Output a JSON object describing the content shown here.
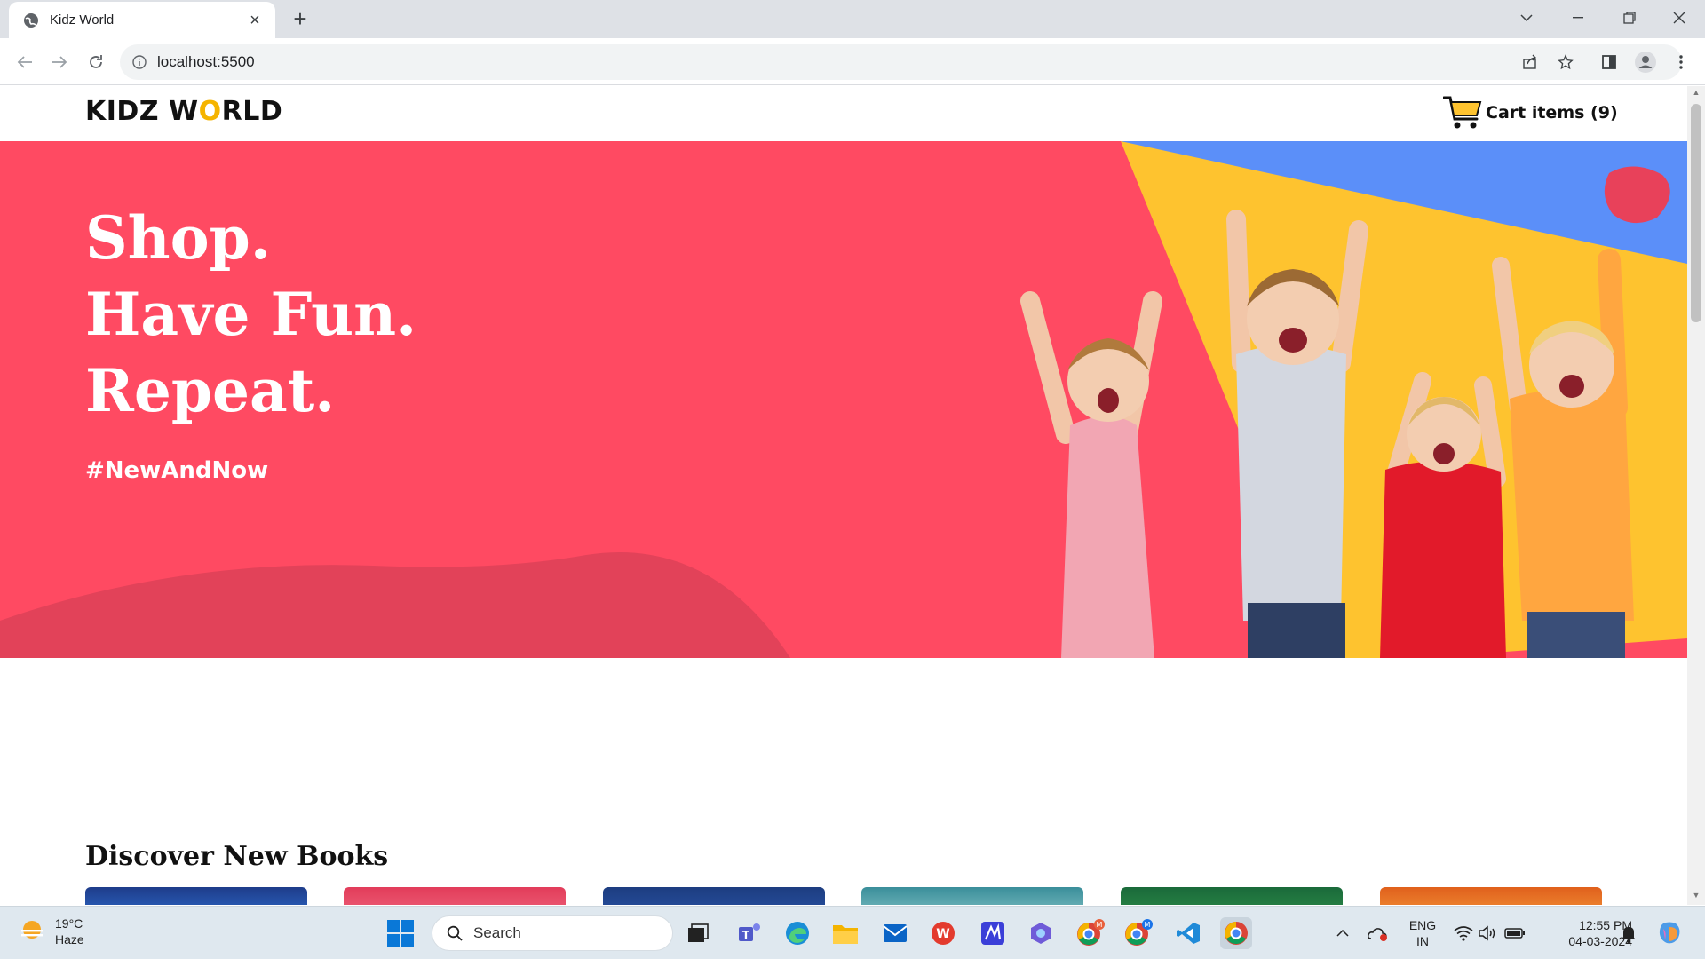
{
  "browser": {
    "tab_title": "Kidz World",
    "url": "localhost:5500"
  },
  "site": {
    "logo_part1": "KIDZ W",
    "logo_o": "O",
    "logo_part2": "RLD",
    "cart_label": "Cart items (9)"
  },
  "hero": {
    "line1": "Shop.",
    "line2": "Have Fun.",
    "line3": "Repeat.",
    "hashtag": "#NewAndNow"
  },
  "discover": {
    "heading": "Discover New Books"
  },
  "taskbar": {
    "temperature": "19°C",
    "condition": "Haze",
    "search_placeholder": "Search",
    "lang1": "ENG",
    "lang2": "IN",
    "time": "12:55 PM",
    "date": "04-03-2024"
  },
  "colors": {
    "hero_red": "#ff4a62",
    "accent_yellow": "#fec32f",
    "accent_blue": "#5b8ff9"
  }
}
